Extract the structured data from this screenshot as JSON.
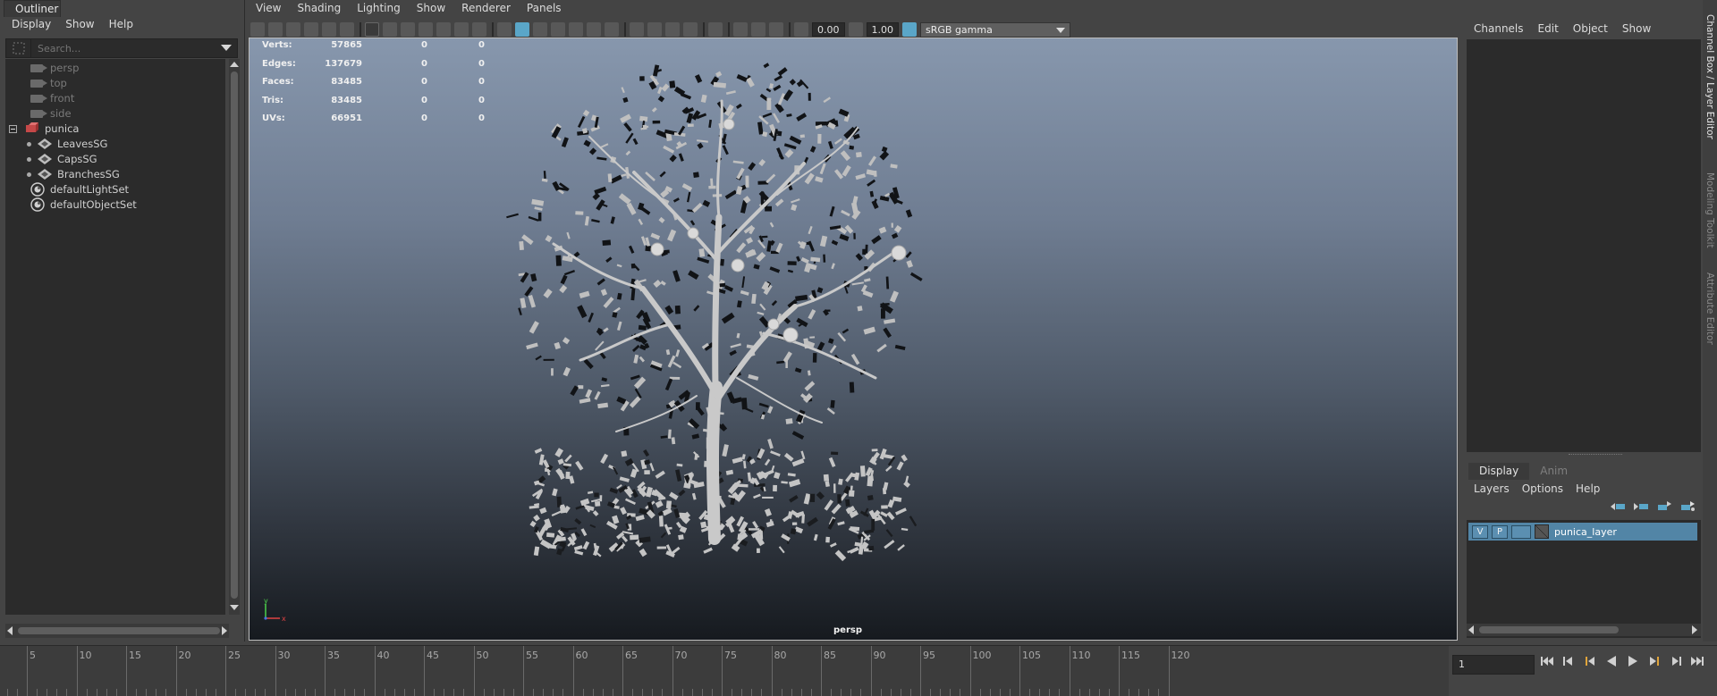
{
  "outliner": {
    "tab_label": "Outliner",
    "menu": [
      "Display",
      "Show",
      "Help"
    ],
    "search_placeholder": "Search...",
    "items": [
      {
        "label": "persp",
        "type": "camera",
        "dim": true
      },
      {
        "label": "top",
        "type": "camera",
        "dim": true
      },
      {
        "label": "front",
        "type": "camera",
        "dim": true
      },
      {
        "label": "side",
        "type": "camera",
        "dim": true
      },
      {
        "label": "punica",
        "type": "mesh-group",
        "dim": false
      },
      {
        "label": "LeavesSG",
        "type": "shading-group",
        "dim": false
      },
      {
        "label": "CapsSG",
        "type": "shading-group",
        "dim": false
      },
      {
        "label": "BranchesSG",
        "type": "shading-group",
        "dim": false
      },
      {
        "label": "defaultLightSet",
        "type": "set",
        "dim": false
      },
      {
        "label": "defaultObjectSet",
        "type": "set",
        "dim": false
      }
    ]
  },
  "viewport": {
    "menu": [
      "View",
      "Shading",
      "Lighting",
      "Show",
      "Renderer",
      "Panels"
    ],
    "toolbar": {
      "exposure": "0.00",
      "gamma": "1.00",
      "color_space": "sRGB gamma"
    },
    "hud": [
      {
        "label": "Verts:",
        "v1": "57865",
        "v2": "0",
        "v3": "0"
      },
      {
        "label": "Edges:",
        "v1": "137679",
        "v2": "0",
        "v3": "0"
      },
      {
        "label": "Faces:",
        "v1": "83485",
        "v2": "0",
        "v3": "0"
      },
      {
        "label": "Tris:",
        "v1": "83485",
        "v2": "0",
        "v3": "0"
      },
      {
        "label": "UVs:",
        "v1": "66951",
        "v2": "0",
        "v3": "0"
      }
    ],
    "camera_label": "persp",
    "axis_x": "x",
    "axis_y": "y"
  },
  "channel_box": {
    "menu": [
      "Channels",
      "Edit",
      "Object",
      "Show"
    ]
  },
  "layer_editor": {
    "tabs": [
      "Display",
      "Anim"
    ],
    "menu": [
      "Layers",
      "Options",
      "Help"
    ],
    "layer": {
      "visible": "V",
      "playback": "P",
      "name": "punica_layer"
    }
  },
  "side_tabs": [
    "Channel Box / Layer Editor",
    "Modeling Toolkit",
    "Attribute Editor"
  ],
  "timeline": {
    "labels": [
      "5",
      "10",
      "15",
      "20",
      "25",
      "30",
      "35",
      "40",
      "45",
      "50",
      "55",
      "60",
      "65",
      "70",
      "75",
      "80",
      "85",
      "90",
      "95",
      "100",
      "105",
      "110",
      "115",
      "120"
    ],
    "current_frame": "1"
  },
  "colors": {
    "accent": "#5aa6c8",
    "layer_selected": "#5285a6",
    "panel_bg": "#444444",
    "field_bg": "#2b2b2b"
  }
}
